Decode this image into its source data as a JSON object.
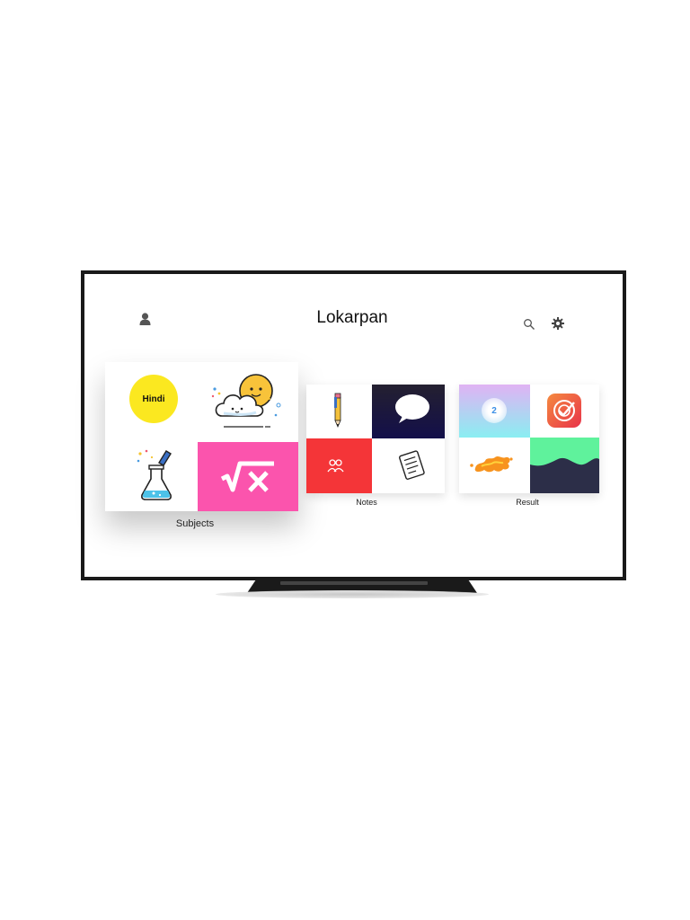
{
  "app": {
    "title": "Lokarpan"
  },
  "header": {
    "user_icon": "user-icon",
    "search_icon": "search-icon",
    "settings_icon": "gear-icon"
  },
  "cards": {
    "subjects": {
      "label": "Subjects",
      "tiles": [
        {
          "name": "hindi",
          "text": "Hindi",
          "color": "#fbe820"
        },
        {
          "name": "weather-cloud",
          "icon": "cloud-sun-icon"
        },
        {
          "name": "science-flask",
          "icon": "flask-icon"
        },
        {
          "name": "math-sqrt",
          "icon": "sqrt-x-icon",
          "color": "#fb54ad"
        }
      ]
    },
    "notes": {
      "label": "Notes",
      "tiles": [
        {
          "name": "pencil",
          "icon": "pencil-icon"
        },
        {
          "name": "chat",
          "icon": "speech-bubble-icon",
          "color": "#1e1e38"
        },
        {
          "name": "group",
          "icon": "people-icon",
          "color": "#f43538"
        },
        {
          "name": "document",
          "icon": "document-icon"
        }
      ]
    },
    "result": {
      "label": "Result",
      "tiles": [
        {
          "name": "badge",
          "text": "2"
        },
        {
          "name": "check-app",
          "icon": "target-check-icon",
          "color": "#ee4a3f"
        },
        {
          "name": "splash",
          "icon": "splash-icon",
          "color": "#f7931e"
        },
        {
          "name": "wave",
          "icon": "wave-icon",
          "color": "#2c2e48"
        }
      ]
    }
  }
}
